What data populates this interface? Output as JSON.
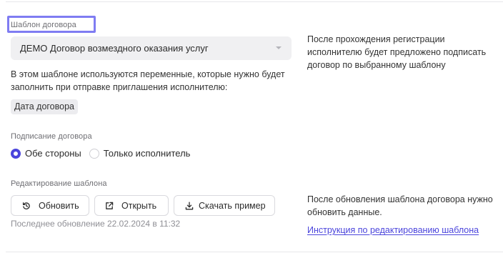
{
  "template_section": {
    "label": "Шаблон договора",
    "selected_template": "ДЕМО Договор возмездного оказания услуг",
    "variables_description": "В этом шаблоне используются переменные, которые нужно будет заполнить при отправке приглашения исполнителю:",
    "variables": [
      "Дата договора"
    ],
    "side_note": "После прохождения регистрации исполнителю будет предложено подписать договор по выбранному шаблону"
  },
  "signing_section": {
    "label": "Подписание договора",
    "options": [
      "Обе стороны",
      "Только исполнитель"
    ],
    "selected": "Обе стороны"
  },
  "editing_section": {
    "label": "Редактирование шаблона",
    "refresh_label": "Обновить",
    "open_label": "Открыть",
    "download_label": "Скачать пример",
    "last_updated": "Последнее обновление 22.02.2024 в 11:32",
    "side_note": "После обновления шаблона договора нужно обновить данные.",
    "instructions_link": "Инструкция по редактированию шаблона"
  },
  "colors": {
    "accent": "#4b45dc",
    "focus_outline": "#7f7cf2"
  }
}
